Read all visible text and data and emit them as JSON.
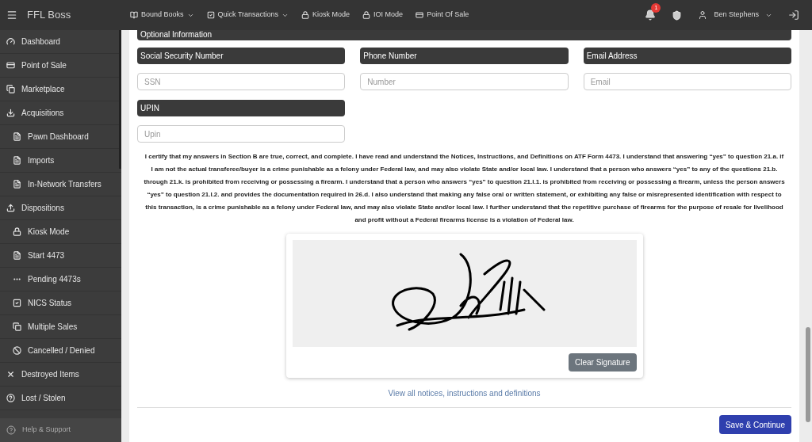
{
  "app": {
    "title": "FFL Boss"
  },
  "nav": [
    {
      "label": "Bound Books",
      "kind": "dropdown"
    },
    {
      "label": "Quick Transactions",
      "kind": "dropdown"
    },
    {
      "label": "Kiosk Mode",
      "kind": "link"
    },
    {
      "label": "IOI Mode",
      "kind": "link"
    },
    {
      "label": "Point Of Sale",
      "kind": "link"
    }
  ],
  "notifications": {
    "count": "1"
  },
  "user": {
    "name": "Ben Stephens"
  },
  "sidebar": {
    "items": [
      {
        "label": "Dashboard"
      },
      {
        "label": "Point of Sale"
      },
      {
        "label": "Marketplace"
      },
      {
        "label": "Acquisitions",
        "children": [
          {
            "label": "Pawn Dashboard"
          },
          {
            "label": "Imports"
          },
          {
            "label": "In-Network Transfers"
          }
        ]
      },
      {
        "label": "Dispositions",
        "children": [
          {
            "label": "Kiosk Mode"
          },
          {
            "label": "Start 4473"
          },
          {
            "label": "Pending 4473s"
          },
          {
            "label": "NICS Status"
          },
          {
            "label": "Multiple Sales"
          },
          {
            "label": "Cancelled / Denied"
          }
        ]
      },
      {
        "label": "Destroyed Items"
      },
      {
        "label": "Lost / Stolen"
      }
    ],
    "help": "Help & Support"
  },
  "section_title": "Optional Information",
  "fields": [
    {
      "label": "Social Security Number",
      "placeholder": "SSN"
    },
    {
      "label": "Phone Number",
      "placeholder": "Number"
    },
    {
      "label": "Email Address",
      "placeholder": "Email"
    },
    {
      "label": "UPIN",
      "placeholder": "Upin"
    }
  ],
  "certification": "I certify that my answers in Section B are true, correct, and complete. I have read and understand the Notices, Instructions, and Definitions on ATF Form 4473. I understand that answering “yes” to question 21.a. if I am not the actual transferee/buyer is a crime punishable as a felony under Federal law, and may also violate State and/or local law. I understand that a person who answers “yes” to any of the questions 21.b. through 21.k. is prohibited from receiving or possessing a firearm. I understand that a person who answers “yes” to question 21.l.1. is prohibited from receiving or possessing a firearm, unless the person answers “yes” to question 21.l.2. and provides the documentation required in 26.d. I also understand that making any false oral or written statement, or exhibiting any false or misrepresented identification with respect to this transaction, is a crime punishable as a felony under Federal law, and may also violate State and/or local law. I further understand that the repetitive purchase of firearms for the purpose of resale for livelihood and profit without a Federal firearms license is a violation of Federal law.",
  "signature": {
    "clear_button": "Clear Signature"
  },
  "notices_link": "View all notices, instructions and definitions",
  "save_button": "Save & Continue"
}
